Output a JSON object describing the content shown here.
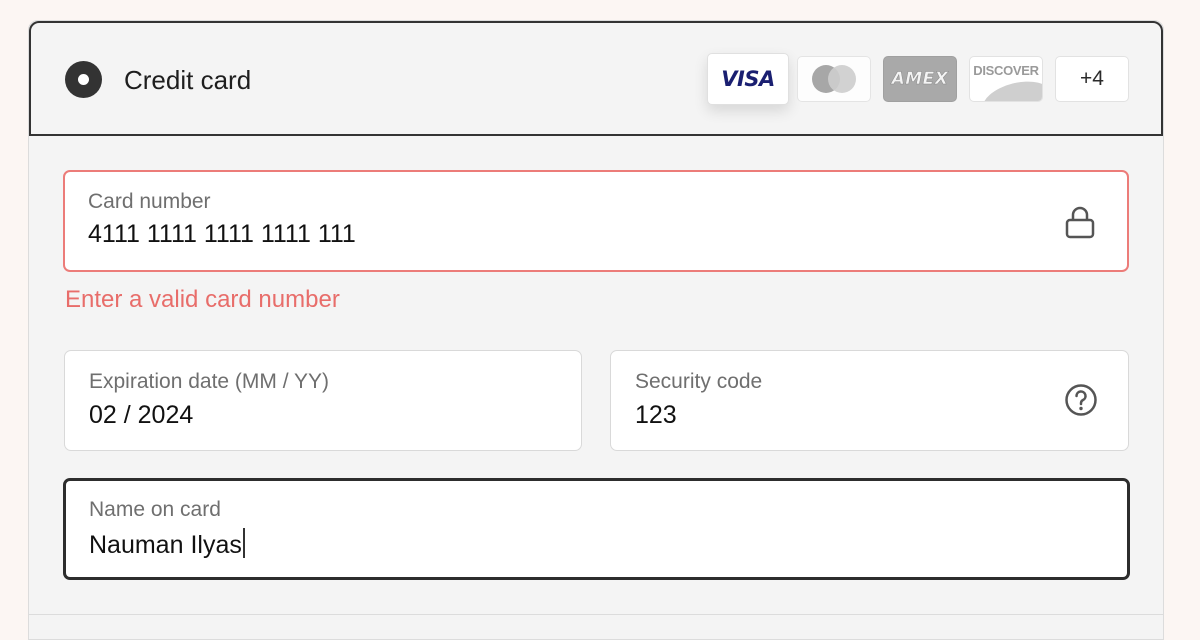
{
  "payment_method": {
    "label": "Credit card",
    "selected": true
  },
  "card_brands": {
    "visa": "VISA",
    "mastercard_icon": "mastercard-logo-icon",
    "amex": "AMEX",
    "discover": "DISCOVER",
    "more": "+4"
  },
  "card_number": {
    "label": "Card number",
    "value": "4111 1111 1111 1111 111",
    "icon": "lock-icon",
    "error": "Enter a valid card number"
  },
  "expiration": {
    "label": "Expiration date (MM / YY)",
    "value": "02 / 2024"
  },
  "security_code": {
    "label": "Security code",
    "value": "123",
    "icon": "help-icon"
  },
  "name_on_card": {
    "label": "Name on card",
    "value": "Nauman Ilyas"
  },
  "colors": {
    "error": "#e86d6a",
    "focus_border": "#2d2d2d",
    "visa_blue": "#1a1f71",
    "page_bg": "#fcf6f3"
  }
}
